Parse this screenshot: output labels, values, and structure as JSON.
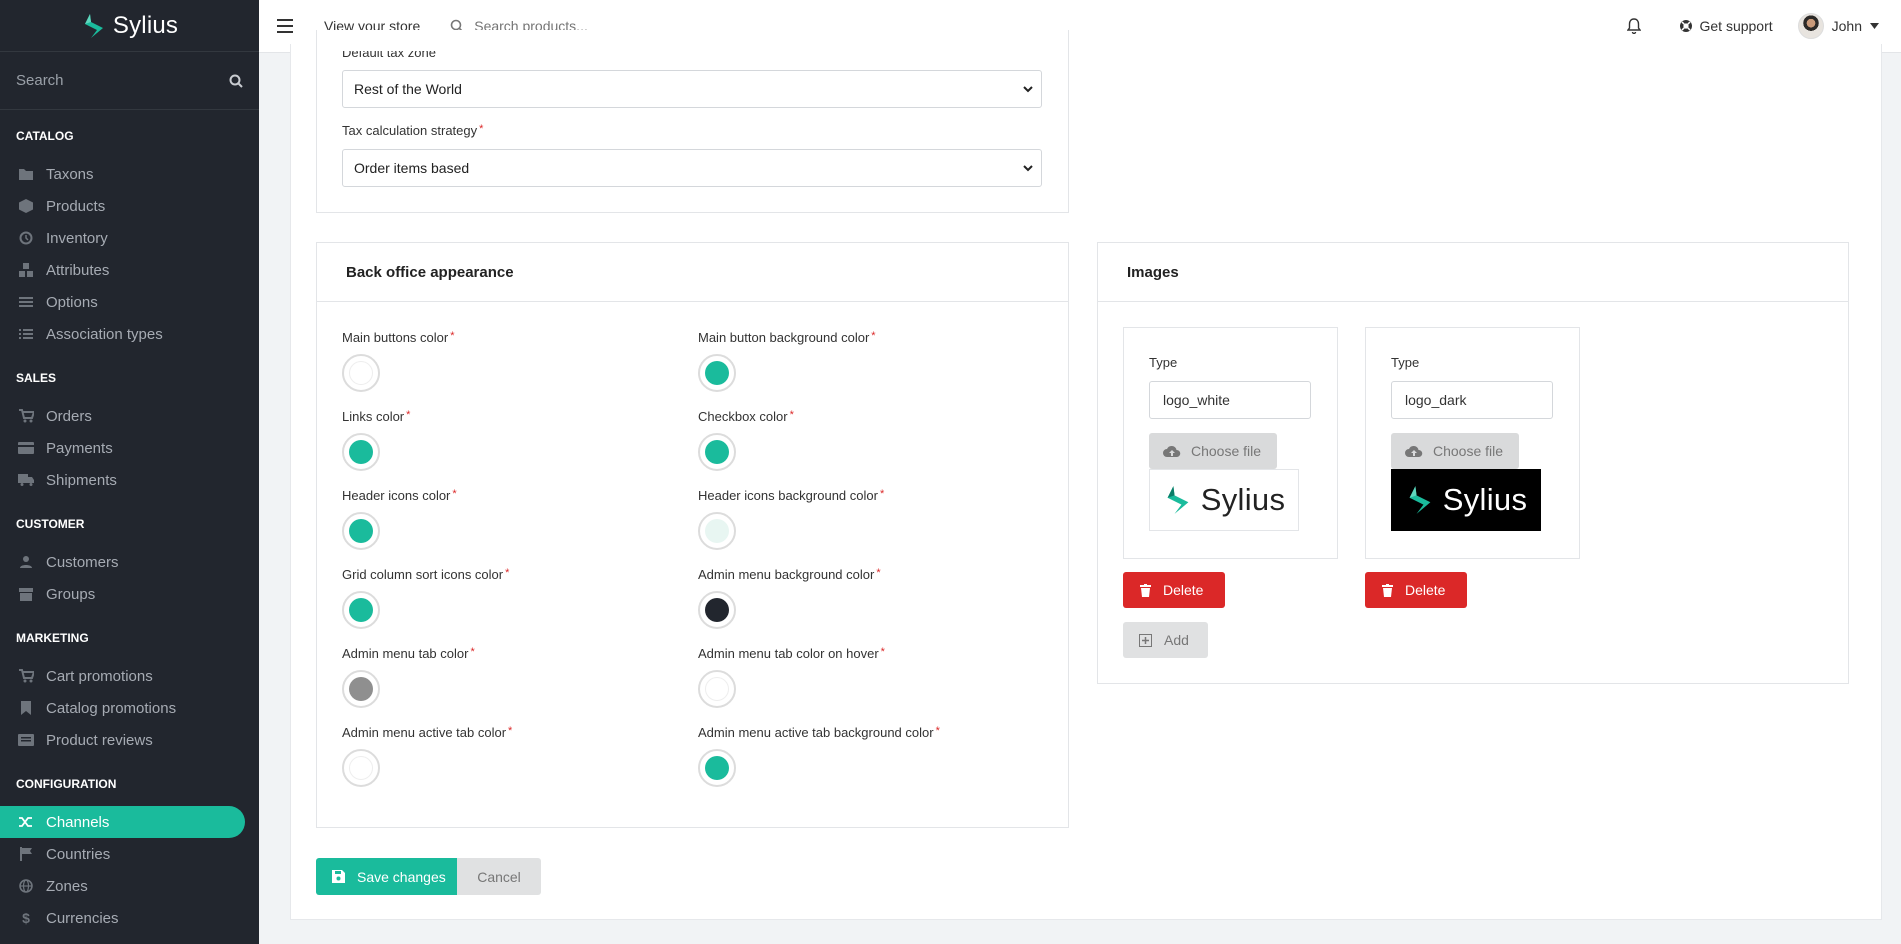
{
  "app": {
    "name": "Sylius"
  },
  "sidebar": {
    "search_label": "Search",
    "sections": [
      {
        "title": "CATALOG",
        "items": [
          {
            "label": "Taxons",
            "icon": "folder-icon"
          },
          {
            "label": "Products",
            "icon": "cube-icon"
          },
          {
            "label": "Inventory",
            "icon": "history-icon"
          },
          {
            "label": "Attributes",
            "icon": "cubes-icon"
          },
          {
            "label": "Options",
            "icon": "sliders-icon"
          },
          {
            "label": "Association types",
            "icon": "list-icon"
          }
        ]
      },
      {
        "title": "SALES",
        "items": [
          {
            "label": "Orders",
            "icon": "cart-icon"
          },
          {
            "label": "Payments",
            "icon": "credit-card-icon"
          },
          {
            "label": "Shipments",
            "icon": "truck-icon"
          }
        ]
      },
      {
        "title": "CUSTOMER",
        "items": [
          {
            "label": "Customers",
            "icon": "users-icon"
          },
          {
            "label": "Groups",
            "icon": "archive-icon"
          }
        ]
      },
      {
        "title": "MARKETING",
        "items": [
          {
            "label": "Cart promotions",
            "icon": "cart-icon"
          },
          {
            "label": "Catalog promotions",
            "icon": "bookmark-icon"
          },
          {
            "label": "Product reviews",
            "icon": "newspaper-icon"
          }
        ]
      },
      {
        "title": "CONFIGURATION",
        "items": [
          {
            "label": "Channels",
            "icon": "shuffle-icon",
            "active": true
          },
          {
            "label": "Countries",
            "icon": "flag-icon"
          },
          {
            "label": "Zones",
            "icon": "globe-icon"
          },
          {
            "label": "Currencies",
            "icon": "dollar-icon"
          }
        ]
      }
    ]
  },
  "topbar": {
    "view_store": "View your store",
    "search_placeholder": "Search products...",
    "support": "Get support",
    "user": "John"
  },
  "tax": {
    "default_zone_label": "Default tax zone",
    "default_zone_value": "Rest of the World",
    "strategy_label": "Tax calculation strategy",
    "strategy_value": "Order items based"
  },
  "appearance": {
    "title": "Back office appearance",
    "fields": [
      {
        "label": "Main buttons color",
        "color": "#ffffff"
      },
      {
        "label": "Main button background color",
        "color": "#1abb9c"
      },
      {
        "label": "Links color",
        "color": "#1abb9c"
      },
      {
        "label": "Checkbox color",
        "color": "#1abb9c"
      },
      {
        "label": "Header icons color",
        "color": "#1abb9c"
      },
      {
        "label": "Header icons background color",
        "color": "#e8f6f2"
      },
      {
        "label": "Grid column sort icons color",
        "color": "#1abb9c"
      },
      {
        "label": "Admin menu background color",
        "color": "#22262e"
      },
      {
        "label": "Admin menu tab color",
        "color": "#8f8f8f"
      },
      {
        "label": "Admin menu tab color on hover",
        "color": "#ffffff"
      },
      {
        "label": "Admin menu active tab color",
        "color": "#ffffff"
      },
      {
        "label": "Admin menu active tab background color",
        "color": "#1abb9c"
      }
    ]
  },
  "images": {
    "title": "Images",
    "type_label": "Type",
    "choose_file": "Choose file",
    "delete": "Delete",
    "add": "Add",
    "logo_text": "Sylius",
    "items": [
      {
        "type": "logo_white"
      },
      {
        "type": "logo_dark"
      }
    ]
  },
  "actions": {
    "save": "Save changes",
    "cancel": "Cancel"
  },
  "colors": {
    "accent": "#1abb9c",
    "danger": "#db2828",
    "sidebar_bg": "#22262e"
  }
}
